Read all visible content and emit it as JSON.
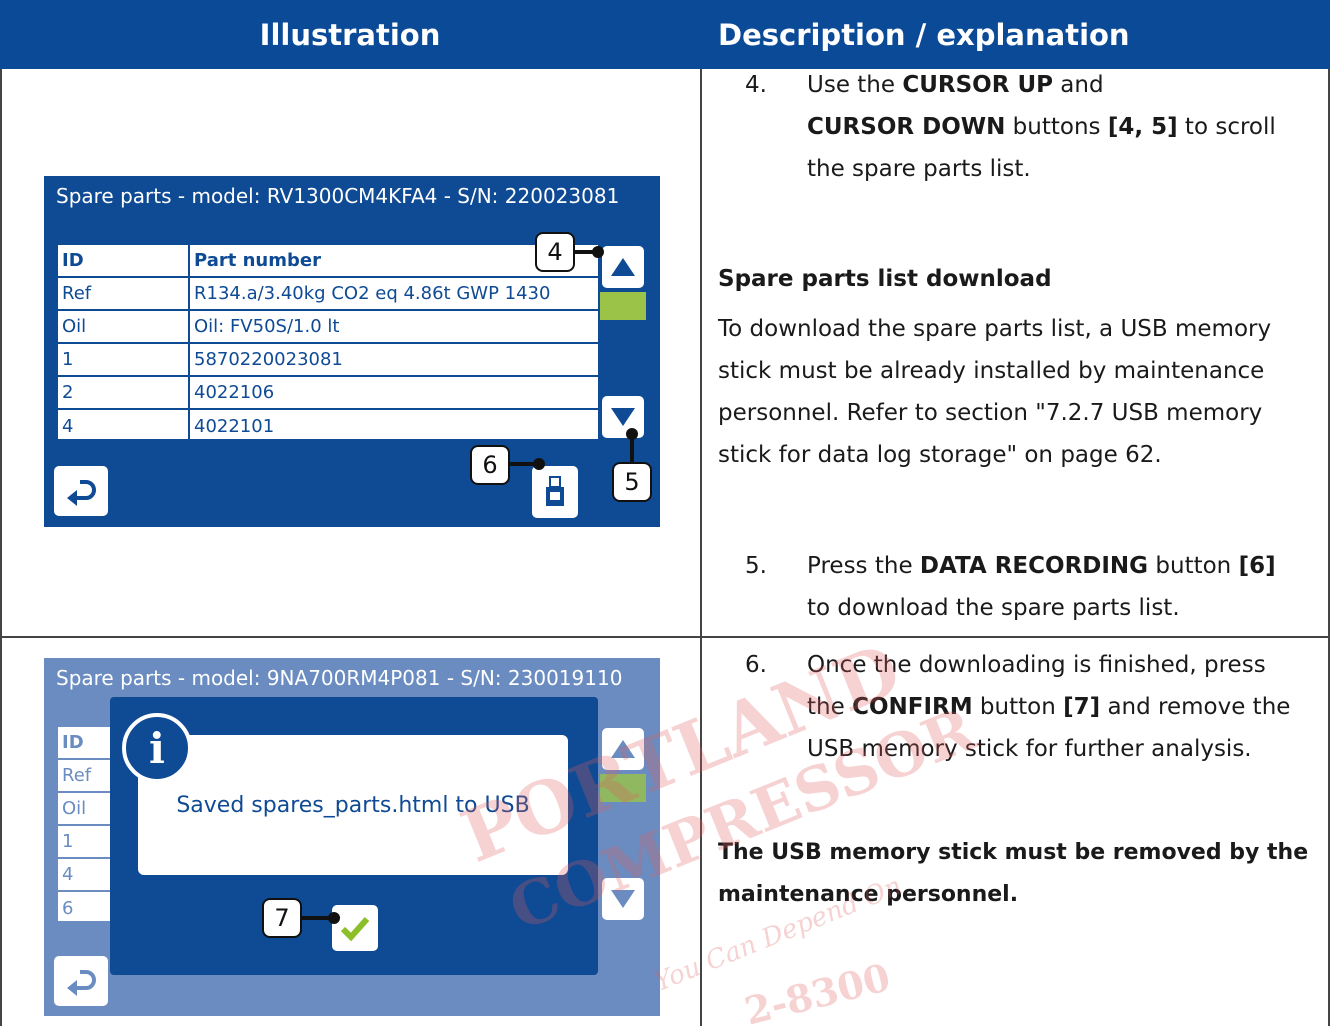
{
  "header": {
    "col1": "Illustration",
    "col2": "Description / explanation"
  },
  "row1": {
    "step4": {
      "num": "4.",
      "line1_pre": "Use the ",
      "line1_bold": "CURSOR UP",
      "line1_post": " and",
      "line2_bold": "CURSOR DOWN",
      "line2_mid": " buttons ",
      "line2_ref": "[4, 5]",
      "line2_post": " to scroll",
      "line3": "the spare parts list."
    },
    "download_heading": "Spare parts list download",
    "download_text": [
      "To download the spare parts list, a USB memory",
      "stick must be already installed by maintenance",
      "personnel. Refer to section \"7.2.7 USB memory",
      "stick for data log storage\" on page 62."
    ],
    "step5": {
      "num": "5.",
      "line1_pre": "Press the ",
      "line1_bold": "DATA RECORDING",
      "line1_mid": " button ",
      "line1_ref": "[6]",
      "line2": "to download the spare parts list."
    },
    "screen": {
      "title": "Spare parts - model: RV1300CM4KFA4 - S/N: 220023081",
      "col_id": "ID",
      "col_part": "Part number",
      "rows": [
        {
          "id": "Ref",
          "part": "R134.a/3.40kg CO2 eq 4.86t GWP 1430"
        },
        {
          "id": "Oil",
          "part": "Oil:  FV50S/1.0 lt"
        },
        {
          "id": "1",
          "part": "5870220023081"
        },
        {
          "id": "2",
          "part": "4022106"
        },
        {
          "id": "4",
          "part": "4022101"
        }
      ],
      "callout_4": "4",
      "callout_5": "5",
      "callout_6": "6"
    }
  },
  "row2": {
    "step6": {
      "num": "6.",
      "line1": "Once the downloading is finished, press",
      "line2_pre": "the ",
      "line2_bold": "CONFIRM",
      "line2_mid": " button ",
      "line2_ref": "[7]",
      "line2_post": " and remove the",
      "line3": "USB memory stick for further analysis."
    },
    "warning_line1": "The USB memory stick must be removed by the",
    "warning_line2": "maintenance personnel.",
    "screen": {
      "title": "Spare parts - model: 9NA700RM4P081 - S/N: 230019110",
      "col_id": "ID",
      "ids": [
        "Ref",
        "Oil",
        "1",
        "4",
        "6"
      ],
      "dialog_message": "Saved spares_parts.html to USB",
      "info_glyph": "i",
      "callout_7": "7"
    }
  },
  "watermark": {
    "line1": "PORTLAND",
    "line2": "COMPRESSOR",
    "line3": "You Can Depend On",
    "line4": "2-8300"
  },
  "colors": {
    "header_blue": "#0b4a97",
    "screen_blue": "#0f4a94",
    "accent_green": "#9ac347",
    "watermark": "#e05e5e"
  }
}
